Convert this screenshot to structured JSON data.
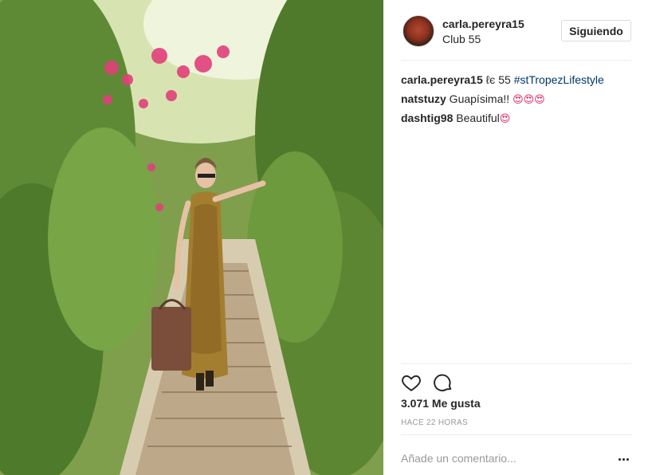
{
  "post": {
    "username": "carla.pereyra15",
    "location": "Club 55",
    "follow_label": "Siguiendo",
    "likes": "3.071 Me gusta",
    "time": "HACE 22 HORAS",
    "comment_placeholder": "Añade un comentario..."
  },
  "comments": [
    {
      "user": "carla.pereyra15",
      "text": " ℓє 55 ",
      "hashtag": "#stTropezLifestyle",
      "emoji": ""
    },
    {
      "user": "natstuzy",
      "text": " Guapísima!! ",
      "hashtag": "",
      "emoji": "😍😍😍"
    },
    {
      "user": "dashtig98",
      "text": " Beautiful",
      "hashtag": "",
      "emoji": "😍"
    }
  ],
  "icons": {
    "like": "heart-icon",
    "comment": "comment-bubble-icon",
    "more": "more-options-icon"
  }
}
